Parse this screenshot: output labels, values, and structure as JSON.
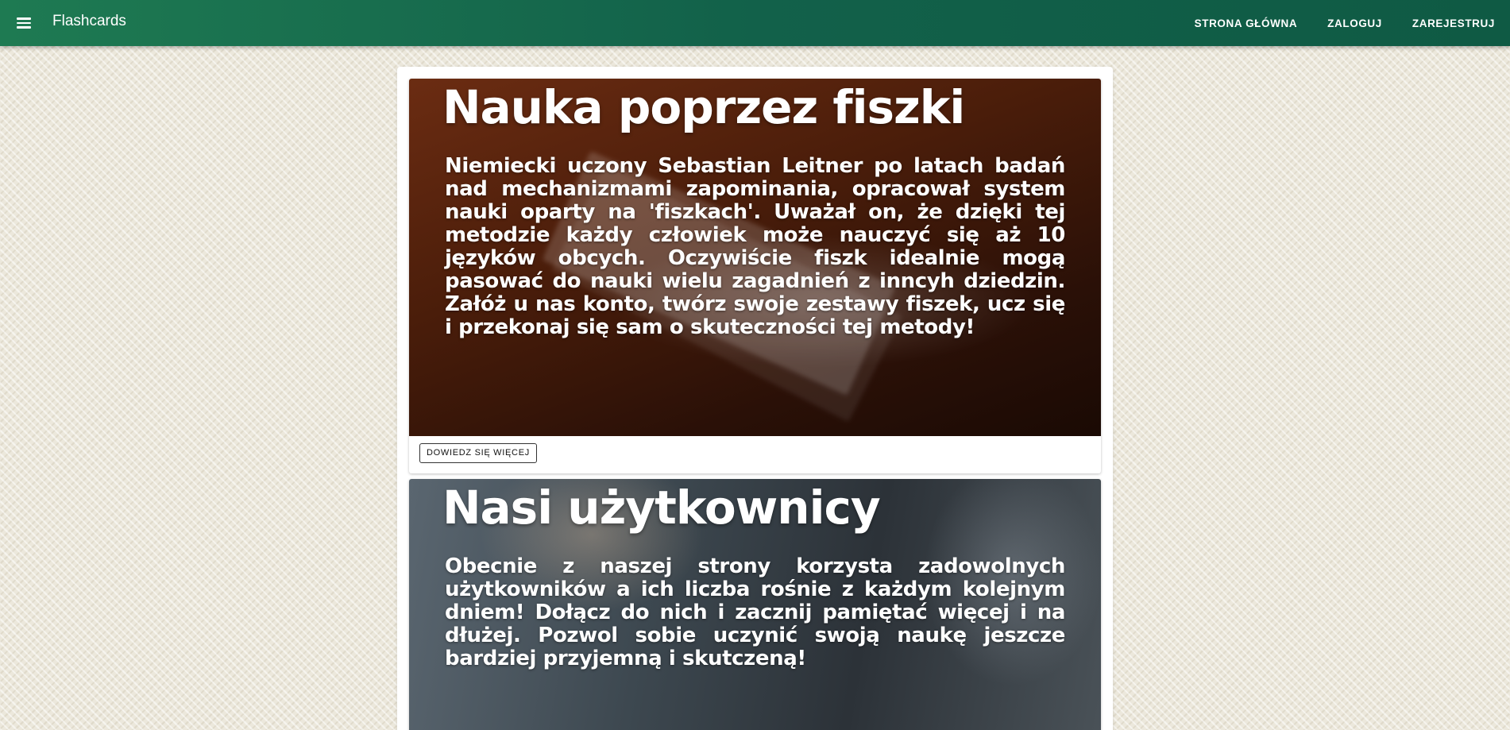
{
  "header": {
    "menu_icon": "hamburger-menu-icon",
    "title": "Flashcards",
    "nav": [
      {
        "label": "STRONA GŁÓWNA"
      },
      {
        "label": "ZALOGUJ"
      },
      {
        "label": "ZAREJESTRUJ"
      }
    ]
  },
  "cards": [
    {
      "title": "Nauka poprzez fiszki",
      "text": "Niemiecki uczony Sebastian Leitner po latach badań nad mechanizmami zapominania, opracował system nauki oparty na 'fiszkach'. Uważał on, że dzięki tej metodzie każdy człowiek może nauczyć się aż 10 języków obcych. Oczywiście fiszk idealnie mogą pasować do nauki wielu zagadnień z inncyh dziedzin. Załóż u nas konto, twórz swoje zestawy fiszek, ucz się i przekonaj się sam o skuteczności tej metody!",
      "button_label": "DOWIEDZ SIĘ WIĘCEJ"
    },
    {
      "title": "Nasi użytkownicy",
      "text": "Obecnie z naszej strony korzysta zadowolnych użytkowników a ich liczba rośnie z każdym kolejnym dniem! Dołącz do nich i zacznij pamiętać więcej i na dłużej. Pozwol sobie uczynić swoją naukę jeszcze bardziej przyjemną i skutczeną!"
    }
  ]
}
